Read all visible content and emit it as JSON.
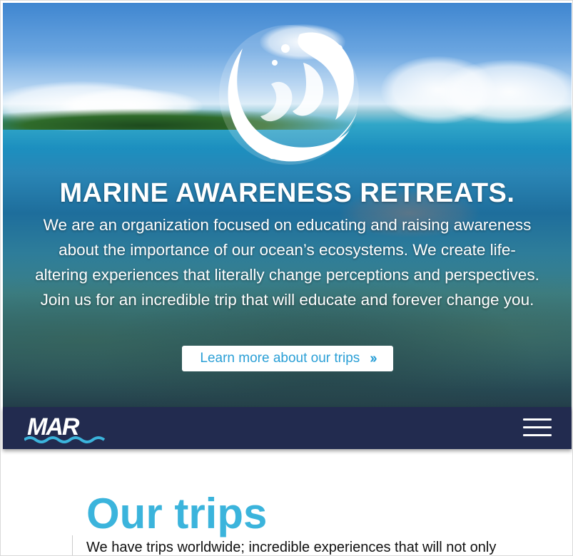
{
  "hero": {
    "logo_icon": "water-splash-circle-icon",
    "title": "MARINE AWARENESS RETREATS.",
    "description": "We are an organization focused on educating and raising awareness about the importance of our ocean’s ecosystems. We create life-altering experiences that literally change perceptions and perspectives. Join us for an incredible trip that will educate and forever change you.",
    "cta_label": "Learn more about our trips",
    "cta_icon": "double-chevron-right-icon"
  },
  "nav": {
    "logo_text": "MAR",
    "menu_icon": "hamburger-menu-icon",
    "background": "#222b4f"
  },
  "trips": {
    "heading": "Our trips",
    "intro": "We have trips worldwide; incredible experiences that will not only"
  },
  "colors": {
    "accent": "#3bb4dc",
    "button_text": "#2a9fd6",
    "nav_bg": "#222b4f"
  }
}
